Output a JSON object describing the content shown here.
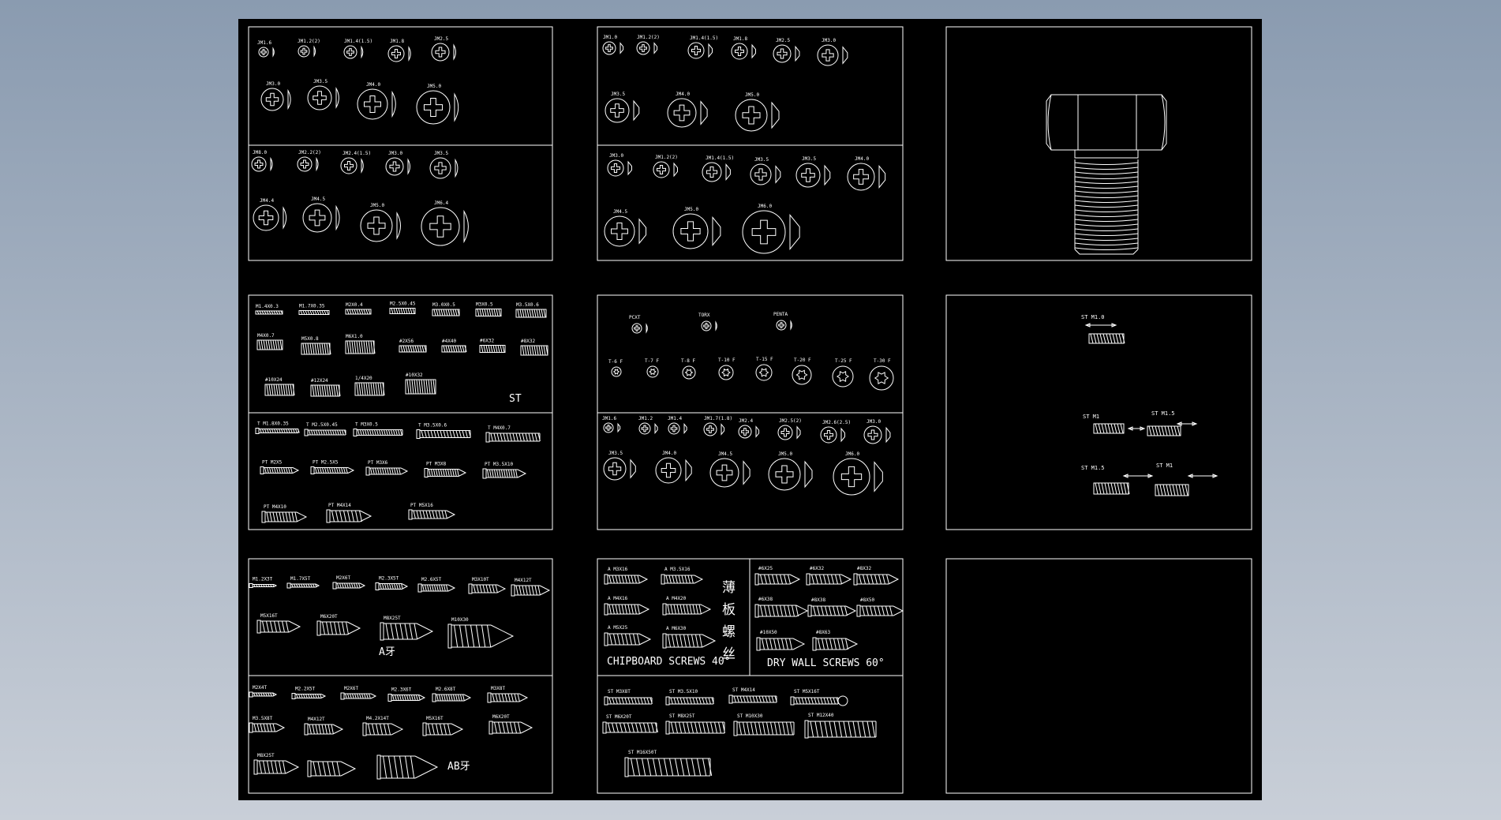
{
  "colors": {
    "background_gradient_top": "#8a9bb0",
    "background_gradient_bottom": "#c9cfd8",
    "sheet": "#000000",
    "lines": "#ffffff"
  },
  "panel_pm": {
    "top_labels": [
      "JM1.6",
      "JM1.2(2)",
      "JM1.4(1.5)",
      "JM1.8",
      "JM2.5",
      "JM3.0",
      "JM3.5",
      "JM4.0",
      "JM5.0"
    ],
    "bottom_labels": [
      "JM8.0",
      "JM2.2(2)",
      "JM2.4(1.5)",
      "JM3.0",
      "JM3.5",
      "JM4.4",
      "JM4.5",
      "JM5.0",
      "JM6.4"
    ]
  },
  "panel_km": {
    "top_labels": [
      "JM1.0",
      "JM1.2(2)",
      "JM1.4(1.5)",
      "JM1.8",
      "JM2.5",
      "JM3.0",
      "JM3.5",
      "JM4.0",
      "JM5.0"
    ],
    "bottom_labels": [
      "JM3.0",
      "JM1.2(2)",
      "JM1.4(1.5)",
      "JM3.5",
      "JM3.5",
      "JM4.0",
      "JM4.5",
      "JM5.0",
      "JM6.0"
    ]
  },
  "panel_st": {
    "top_labels": [
      "M1.4X0.3",
      "M1.7X0.35",
      "M2X0.4",
      "M2.5X0.45",
      "M3.0X0.5",
      "M3X0.5",
      "M3.5X0.6",
      "M4X0.7",
      "M5X0.8",
      "M6X1.0",
      "#2X56",
      "#4X40",
      "#6X32",
      "#8X32",
      "#10X24",
      "#12X24",
      "1/4X20",
      "#10X32"
    ],
    "st_label": "ST",
    "bottom_labels": [
      "T M1.8X0.35",
      "T M2.5X0.45",
      "T M3X0.5",
      "T M3.5X0.6",
      "T M4X0.7",
      "PT M2X5",
      "PT M2.5X5",
      "PT M3X6",
      "PT M3X8",
      "PT M3.5X10",
      "PT M4X10",
      "PT M4X14",
      "PT M5X16"
    ]
  },
  "panel_torx": {
    "row1_labels": [
      "PCXT",
      "TORX",
      "PENTA"
    ],
    "torx_labels": [
      "T-6 F",
      "T-7 F",
      "T-8 F",
      "T-10 F",
      "T-15 F",
      "T-20 F",
      "T-25 F",
      "T-30 F"
    ],
    "row3_labels": [
      "JM1.6",
      "JM1.2",
      "JM1.4",
      "JM1.7(1.8)",
      "JM2.4",
      "JM2.5(2)",
      "JM2.6(2.5)",
      "JM3.0"
    ],
    "row4_labels": [
      "JM3.5",
      "JM4.0",
      "JM4.5",
      "JM5.0",
      "JM6.0"
    ]
  },
  "panel_thread": {
    "label_top": "ST M1.0",
    "label_a": "ST M1",
    "label_b": "ST M1.5",
    "label_c": "ST M1.5",
    "label_d": "ST M1"
  },
  "panel_a": {
    "top_labels": [
      "M1.2X3T",
      "M1.7X5T",
      "M2X6T",
      "M2.3X5T",
      "M2.6X5T",
      "M3X10T",
      "M4X12T",
      "M5X16T",
      "M6X20T",
      "M8X25T",
      "M10X30"
    ],
    "a_label": "A牙",
    "bottom_labels": [
      "M2X4T",
      "M2.2X5T",
      "M2X6T",
      "M2.3X6T",
      "M2.6X8T",
      "M3X8T",
      "M3.5X8T",
      "M4X12T",
      "M4.2X14T",
      "M5X16T",
      "M6X20T",
      "M8X25T"
    ],
    "ab_label": "AB牙"
  },
  "panel_chipboard": {
    "left_labels": [
      "A M3X16",
      "A M3.5X16",
      "A M4X16",
      "A M4X20",
      "A M5X25",
      "A M6X30"
    ],
    "vertical_text": [
      "薄",
      "板",
      "螺",
      "丝"
    ],
    "chipboard_caption": "CHIPBOARD SCREWS 40°",
    "right_labels": [
      "#6X25",
      "#6X32",
      "#8X32",
      "#6X38",
      "#8X38",
      "#8X50",
      "#10X50",
      "#8X63"
    ],
    "drywall_caption": "DRY WALL SCREWS 60°",
    "bottom_labels": [
      "ST M3X8T",
      "ST M3.5X10",
      "ST M4X14",
      "ST M5X16T",
      "ST M6X20T",
      "ST M8X25T",
      "ST M10X30",
      "ST M12X40",
      "ST M16X50T"
    ]
  }
}
